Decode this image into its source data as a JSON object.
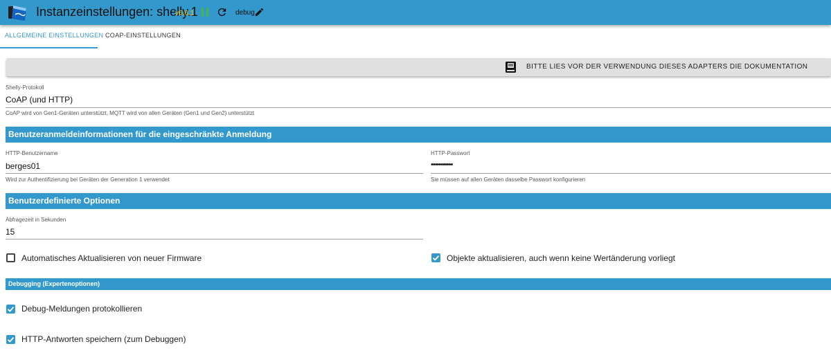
{
  "header": {
    "title": "Instanzeinstellungen: shelly.1",
    "version": "v6.6.1",
    "loglevel": "debug",
    "colors": {
      "bar": "#3399cc",
      "version": "#ffc107",
      "pause": "#4caf50"
    }
  },
  "tabs": [
    {
      "label": "ALLGEMEINE EINSTELLUNGEN",
      "active": true
    },
    {
      "label": "COAP-EINSTELLUNGEN",
      "active": false
    }
  ],
  "doc_button": {
    "label": "BITTE LIES VOR DER VERWENDUNG DIESES ADAPTERS DIE DOKUMENTATION",
    "icon": "book-icon"
  },
  "protocol": {
    "label": "Shelly-Protokoll",
    "value": "CoAP (und HTTP)",
    "help": "CoAP wird von Gen1-Geräten unterstützt, MQTT wird von allen Geräten (Gen1 und Gen2) unterstützt"
  },
  "sections": {
    "credentials": "Benutzeranmeldeinformationen für die eingeschränkte Anmeldung",
    "custom": "Benutzerdefinierte Optionen",
    "debugging": "Debugging (Expertenoptionen)"
  },
  "http_username": {
    "label": "HTTP-Benutzername",
    "value": "berges01",
    "help": "Wird zur Authentifizierung bei Geräten der Generation 1 verwendet"
  },
  "http_password": {
    "label": "HTTP-Passwort",
    "value": "•••••••••••",
    "help": "Sie müssen auf allen Geräten dasselbe Passwort konfigurieren"
  },
  "poll_interval": {
    "label": "Abfragezeit in Sekunden",
    "value": "15"
  },
  "checkboxes": {
    "auto_update": {
      "label": "Automatisches Aktualisieren von neuer Firmware",
      "checked": false
    },
    "update_unchanged": {
      "label": "Objekte aktualisieren, auch wenn keine Wertänderung vorliegt",
      "checked": true
    },
    "debug_log": {
      "label": "Debug-Meldungen protokollieren",
      "checked": true
    },
    "save_http": {
      "label": "HTTP-Antworten speichern (zum Debuggen)",
      "checked": true
    }
  }
}
